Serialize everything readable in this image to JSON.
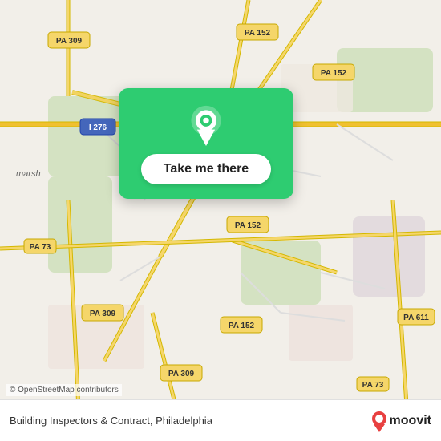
{
  "map": {
    "background_color": "#f2efe9",
    "attribution": "© OpenStreetMap contributors"
  },
  "card": {
    "button_label": "Take me there",
    "pin_icon": "location-pin"
  },
  "bottom_bar": {
    "business_name": "Building Inspectors & Contract, Philadelphia",
    "logo_text": "moovit"
  },
  "road_labels": [
    {
      "id": "pa309-nw",
      "text": "PA 309"
    },
    {
      "id": "pa152-n",
      "text": "PA 152"
    },
    {
      "id": "i276",
      "text": "I 276"
    },
    {
      "id": "pa152-ne",
      "text": "PA 152"
    },
    {
      "id": "pa73-w",
      "text": "PA 73"
    },
    {
      "id": "pa152-mid",
      "text": "PA 152"
    },
    {
      "id": "pa309-mid",
      "text": "PA 309"
    },
    {
      "id": "pa309-s",
      "text": "PA 309"
    },
    {
      "id": "pa152-s",
      "text": "PA 152"
    },
    {
      "id": "pa73-e",
      "text": "PA 73"
    },
    {
      "id": "pa611",
      "text": "PA 611"
    },
    {
      "id": "marsh",
      "text": "marsh"
    }
  ]
}
